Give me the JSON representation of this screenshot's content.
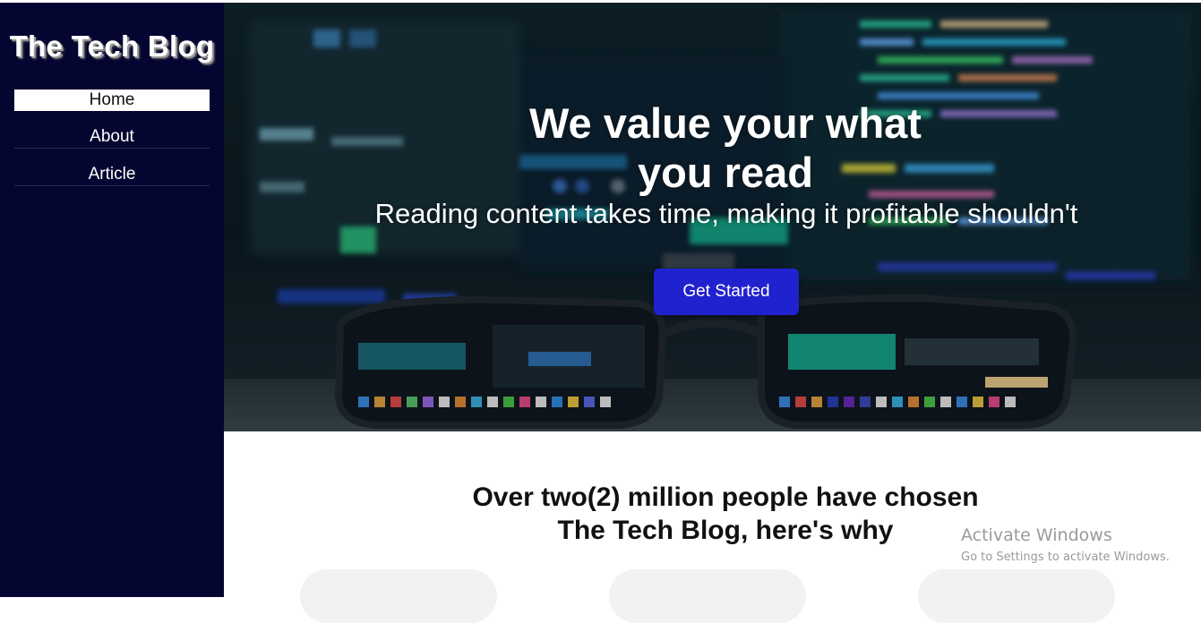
{
  "sidebar": {
    "title": "The Tech Blog",
    "items": [
      {
        "label": "Home",
        "active": true
      },
      {
        "label": "About",
        "active": false
      },
      {
        "label": "Article",
        "active": false
      }
    ]
  },
  "hero": {
    "title": "We value your what you read",
    "subtitle": "Reading content takes time, making it profitable shouldn't",
    "cta_label": "Get Started"
  },
  "section": {
    "heading": "Over two(2) million people have chosen The Tech Blog, here's why"
  },
  "watermark": {
    "line1": "Activate Windows",
    "line2": "Go to Settings to activate Windows."
  },
  "colors": {
    "sidebar_bg": "#040530",
    "cta_bg": "#2122cf",
    "text_light": "#ffffff"
  }
}
